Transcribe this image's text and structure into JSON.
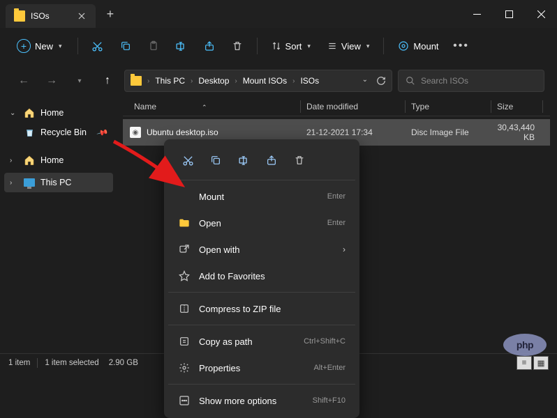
{
  "window": {
    "title": "ISOs"
  },
  "toolbar": {
    "new_label": "New",
    "sort_label": "Sort",
    "view_label": "View",
    "mount_label": "Mount"
  },
  "breadcrumb": {
    "items": [
      "This PC",
      "Desktop",
      "Mount ISOs",
      "ISOs"
    ]
  },
  "search": {
    "placeholder": "Search ISOs"
  },
  "sidebar": {
    "items": [
      {
        "label": "Home",
        "expanded": true
      },
      {
        "label": "Recycle Bin",
        "pinned": true
      },
      {
        "label": "Home",
        "expanded": false
      },
      {
        "label": "This PC",
        "selected": true,
        "expanded": false
      }
    ]
  },
  "columns": {
    "name": "Name",
    "date": "Date modified",
    "type": "Type",
    "size": "Size"
  },
  "files": [
    {
      "name": "Ubuntu desktop.iso",
      "date": "21-12-2021 17:34",
      "type": "Disc Image File",
      "size": "30,43,440 KB"
    }
  ],
  "context_menu": {
    "items": [
      {
        "label": "Mount",
        "hint": "Enter"
      },
      {
        "label": "Open",
        "hint": "Enter"
      },
      {
        "label": "Open with",
        "submenu": true
      },
      {
        "label": "Add to Favorites"
      },
      {
        "label": "Compress to ZIP file"
      },
      {
        "label": "Copy as path",
        "hint": "Ctrl+Shift+C"
      },
      {
        "label": "Properties",
        "hint": "Alt+Enter"
      },
      {
        "label": "Show more options",
        "hint": "Shift+F10"
      }
    ]
  },
  "statusbar": {
    "count": "1 item",
    "selection": "1 item selected",
    "size": "2.90 GB"
  },
  "watermark": "php"
}
